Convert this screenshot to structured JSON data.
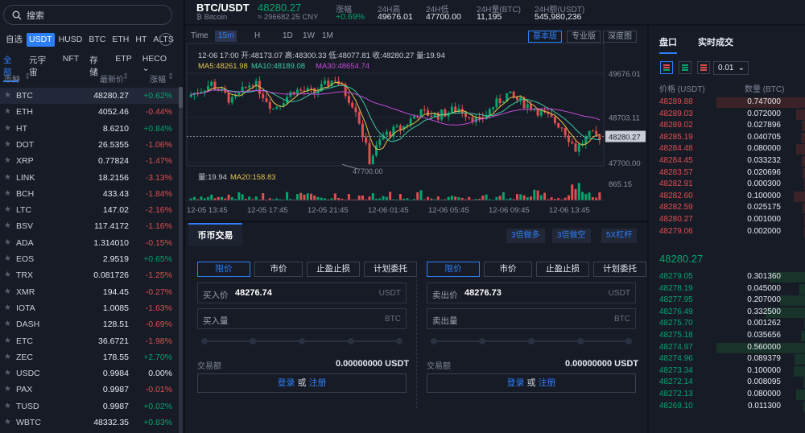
{
  "sidebar": {
    "search_placeholder": "搜索",
    "quote_tabs": [
      "自选",
      "USDT",
      "HUSD",
      "BTC",
      "ETH",
      "HT",
      "ALTS"
    ],
    "active_quote": 1,
    "category_tabs": [
      "全部",
      "元宇宙",
      "NFT",
      "存储",
      "ETP",
      "HECO"
    ],
    "active_category": 0,
    "col_symbol": "币种",
    "col_price": "最新价",
    "col_change": "涨幅",
    "rows": [
      {
        "sym": "BTC",
        "price": "48280.27",
        "chg": "+0.62%",
        "dir": "up"
      },
      {
        "sym": "ETH",
        "price": "4052.46",
        "chg": "-0.44%",
        "dir": "dn"
      },
      {
        "sym": "HT",
        "price": "8.6210",
        "chg": "+0.84%",
        "dir": "up"
      },
      {
        "sym": "DOT",
        "price": "26.5355",
        "chg": "-1.06%",
        "dir": "dn"
      },
      {
        "sym": "XRP",
        "price": "0.77824",
        "chg": "-1.47%",
        "dir": "dn"
      },
      {
        "sym": "LINK",
        "price": "18.2156",
        "chg": "-3.13%",
        "dir": "dn"
      },
      {
        "sym": "BCH",
        "price": "433.43",
        "chg": "-1.84%",
        "dir": "dn"
      },
      {
        "sym": "LTC",
        "price": "147.02",
        "chg": "-2.16%",
        "dir": "dn"
      },
      {
        "sym": "BSV",
        "price": "117.4172",
        "chg": "-1.16%",
        "dir": "dn"
      },
      {
        "sym": "ADA",
        "price": "1.314010",
        "chg": "-0.15%",
        "dir": "dn"
      },
      {
        "sym": "EOS",
        "price": "2.9519",
        "chg": "+0.65%",
        "dir": "up"
      },
      {
        "sym": "TRX",
        "price": "0.081726",
        "chg": "-1.25%",
        "dir": "dn"
      },
      {
        "sym": "XMR",
        "price": "194.45",
        "chg": "-0.27%",
        "dir": "dn"
      },
      {
        "sym": "IOTA",
        "price": "1.0085",
        "chg": "-1.63%",
        "dir": "dn"
      },
      {
        "sym": "DASH",
        "price": "128.51",
        "chg": "-0.69%",
        "dir": "dn"
      },
      {
        "sym": "ETC",
        "price": "36.6721",
        "chg": "-1.98%",
        "dir": "dn"
      },
      {
        "sym": "ZEC",
        "price": "178.55",
        "chg": "+2.70%",
        "dir": "up"
      },
      {
        "sym": "USDC",
        "price": "0.9984",
        "chg": "0.00%",
        "dir": "fl"
      },
      {
        "sym": "PAX",
        "price": "0.9987",
        "chg": "-0.01%",
        "dir": "dn"
      },
      {
        "sym": "TUSD",
        "price": "0.9987",
        "chg": "+0.02%",
        "dir": "up"
      },
      {
        "sym": "WBTC",
        "price": "48332.35",
        "chg": "+0.83%",
        "dir": "up"
      }
    ]
  },
  "header": {
    "pair": "BTC/USDT",
    "coin_name": "Bitcoin",
    "last_price": "48280.27",
    "cny": "≈ 296682.25 CNY",
    "change_label": "涨幅",
    "change_value": "+0.69%",
    "high_label": "24H高",
    "high_value": "49676.01",
    "low_label": "24H低",
    "low_value": "47700.00",
    "vol_label": "24H量(BTC)",
    "vol_value": "11,195",
    "amt_label": "24H额(USDT)",
    "amt_value": "545,980,236"
  },
  "chart_toolbar": {
    "time": "Time",
    "intervals": [
      "15m",
      "H",
      "1D",
      "1W",
      "1M"
    ],
    "active_interval": 0,
    "views": [
      "基本版",
      "专业版",
      "深度图"
    ],
    "active_view": 0
  },
  "chart_data": {
    "type": "candlestick",
    "x_ticks": [
      "12-05 13:45",
      "12-05 17:45",
      "12-05 21:45",
      "12-06 01:45",
      "12-06 05:45",
      "12-06 09:45",
      "12-06 13:45"
    ],
    "y_ticks": [
      "49676.01",
      "48703.11",
      "47700.00"
    ],
    "current_price_tag": "48280.27",
    "low_marker": "47700.00",
    "ohlc_line": "12-06 17:00   开:48173.07  高:48300.33  低:48077.81  收:48280.27  量:19.94",
    "ma5": "MA5:48261.98",
    "ma10": "MA10:48189.08",
    "ma30": "MA30:48654.74",
    "volume_line": "量:19.94",
    "ma20_vol": "MA20:158.83",
    "volume_tick": "865.15",
    "series_colors": {
      "up": "#03a66d",
      "down": "#e04e50",
      "ma5": "#e6c34a",
      "ma10": "#3cc9a0",
      "ma30": "#c14ad6"
    }
  },
  "trade": {
    "title": "币币交易",
    "leverage": [
      "3倍做多",
      "3倍做空",
      "5X杠杆"
    ],
    "order_types": [
      "限价",
      "市价",
      "止盈止损",
      "计划委托"
    ],
    "buy": {
      "price_label": "买入价",
      "price_value": "48276.74",
      "price_unit": "USDT",
      "amount_label": "买入量",
      "amount_unit": "BTC",
      "total_label": "交易额",
      "total_value": "0.00000000 USDT"
    },
    "sell": {
      "price_label": "卖出价",
      "price_value": "48276.73",
      "price_unit": "USDT",
      "amount_label": "卖出量",
      "amount_unit": "BTC",
      "total_label": "交易额",
      "total_value": "0.00000000 USDT"
    },
    "login": "登录",
    "or": "或",
    "register": "注册"
  },
  "orderbook": {
    "tab_book": "盘口",
    "tab_trades": "实时成交",
    "precision": "0.01",
    "col_price": "价格 (USDT)",
    "col_amount": "数量 (BTC)",
    "mid_price": "48280.27",
    "asks": [
      {
        "p": "48289.88",
        "a": "0.747000",
        "d": 1.0
      },
      {
        "p": "48289.03",
        "a": "0.072000",
        "d": 0.1
      },
      {
        "p": "48289.02",
        "a": "0.027896",
        "d": 0.04
      },
      {
        "p": "48285.19",
        "a": "0.040705",
        "d": 0.05
      },
      {
        "p": "48284.48",
        "a": "0.080000",
        "d": 0.1
      },
      {
        "p": "48284.45",
        "a": "0.033232",
        "d": 0.04
      },
      {
        "p": "48283.57",
        "a": "0.020696",
        "d": 0.03
      },
      {
        "p": "48282.91",
        "a": "0.000300",
        "d": 0.01
      },
      {
        "p": "48282.60",
        "a": "0.100000",
        "d": 0.13
      },
      {
        "p": "48282.59",
        "a": "0.025175",
        "d": 0.03
      },
      {
        "p": "48280.27",
        "a": "0.001000",
        "d": 0.01
      },
      {
        "p": "48279.06",
        "a": "0.002000",
        "d": 0.01
      }
    ],
    "bids": [
      {
        "p": "48279.05",
        "a": "0.301360",
        "d": 0.4
      },
      {
        "p": "48278.19",
        "a": "0.045000",
        "d": 0.06
      },
      {
        "p": "48277.95",
        "a": "0.207000",
        "d": 0.28
      },
      {
        "p": "48276.49",
        "a": "0.332500",
        "d": 0.45
      },
      {
        "p": "48275.70",
        "a": "0.001262",
        "d": 0.01
      },
      {
        "p": "48275.18",
        "a": "0.035656",
        "d": 0.05
      },
      {
        "p": "48274.97",
        "a": "0.560000",
        "d": 1.0
      },
      {
        "p": "48274.96",
        "a": "0.089379",
        "d": 0.12
      },
      {
        "p": "48273.34",
        "a": "0.100000",
        "d": 0.13
      },
      {
        "p": "48272.14",
        "a": "0.008095",
        "d": 0.02
      },
      {
        "p": "48272.13",
        "a": "0.080000",
        "d": 0.1
      },
      {
        "p": "48269.10",
        "a": "0.011300",
        "d": 0.02
      }
    ]
  }
}
